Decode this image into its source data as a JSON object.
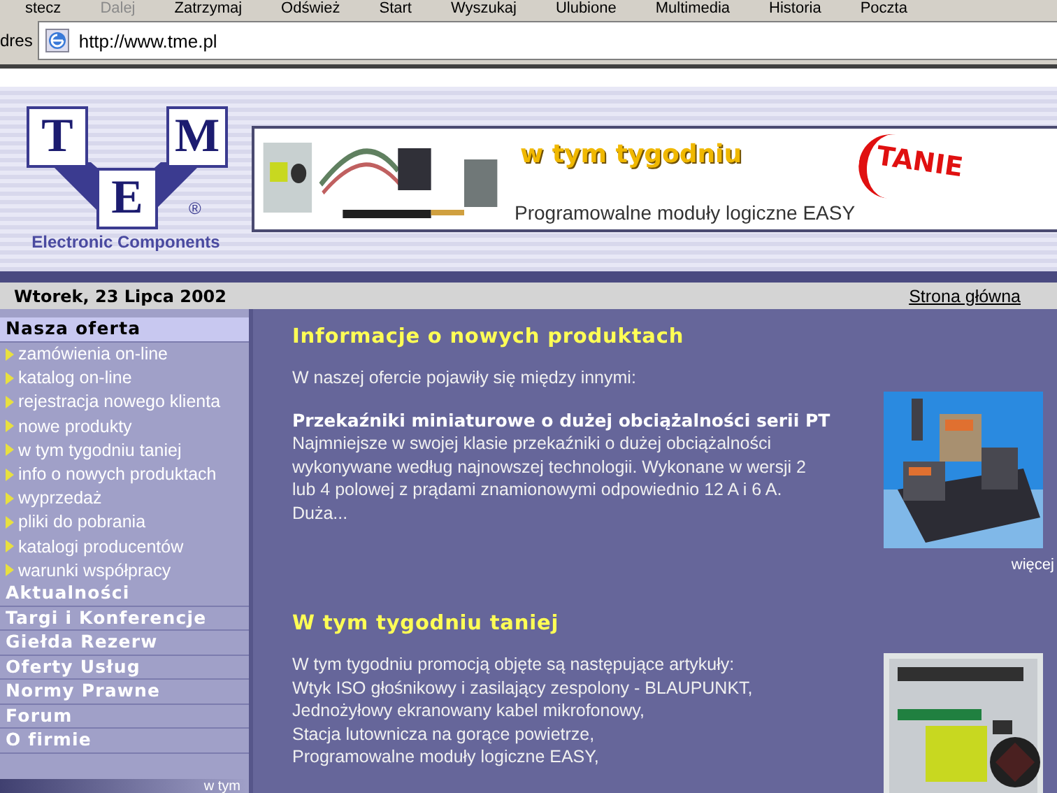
{
  "toolbar": {
    "buttons": [
      {
        "label": "stecz",
        "disabled": false
      },
      {
        "label": "Dalej",
        "disabled": true
      },
      {
        "label": "Zatrzymaj",
        "disabled": false
      },
      {
        "label": "Odśwież",
        "disabled": false
      },
      {
        "label": "Start",
        "disabled": false
      },
      {
        "label": "Wyszukaj",
        "disabled": false
      },
      {
        "label": "Ulubione",
        "disabled": false
      },
      {
        "label": "Multimedia",
        "disabled": false
      },
      {
        "label": "Historia",
        "disabled": false
      },
      {
        "label": "Poczta",
        "disabled": false
      }
    ]
  },
  "address_bar": {
    "label": "dres",
    "value": "http://www.tme.pl"
  },
  "logo": {
    "letters": [
      "T",
      "M",
      "E"
    ],
    "registered": "®",
    "tagline": "Electronic Components"
  },
  "banner": {
    "headline": "w tym tygodniu",
    "stamp": "TANIE",
    "caption": "Programowalne moduły logiczne EASY"
  },
  "date_bar": {
    "date": "Wtorek, 23 Lipca 2002",
    "home_link": "Strona główna"
  },
  "sidebar": {
    "sections": [
      {
        "label": "Nasza oferta",
        "selected": true,
        "items": [
          "zamówienia on-line",
          "katalog on-line",
          "rejestracja nowego klienta",
          "nowe produkty",
          "w tym tygodniu taniej",
          "info o nowych produktach",
          "wyprzedaż",
          "pliki do pobrania",
          "katalogi producentów",
          "warunki współpracy"
        ]
      },
      {
        "label": "Aktualności",
        "selected": false
      },
      {
        "label": "Targi i Konferencje",
        "selected": false
      },
      {
        "label": "Giełda Rezerw",
        "selected": false
      },
      {
        "label": "Oferty Usług",
        "selected": false
      },
      {
        "label": "Normy Prawne",
        "selected": false
      },
      {
        "label": "Forum",
        "selected": false
      },
      {
        "label": "O firmie",
        "selected": false
      }
    ],
    "footer": "w tym"
  },
  "articles": [
    {
      "title": "Informacje o nowych produktach",
      "intro": "W naszej ofercie pojawiły się między innymi:",
      "product_title": "Przekaźniki miniaturowe o dużej obciążalności serii PT",
      "lines": [
        "Najmniejsze w swojej klasie przekaźniki o dużej obciążalności",
        "wykonywane według najnowszej technologii. Wykonane w wersji 2",
        "lub 4 polowej z prądami znamionowymi odpowiednio 12 A i 6 A.",
        "Duża..."
      ],
      "image": {
        "kind": "picture"
      },
      "more": "więcej"
    },
    {
      "title": "W tym tygodniu taniej",
      "lines": [
        "W tym tygodniu promocją objęte są następujące artykuły:",
        "Wtyk ISO głośnikowy i zasilający zespolony - BLAUPUNKT,",
        "Jednożyłowy ekranowany kabel mikrofonowy,",
        "Stacja lutownicza na gorące powietrze,",
        "Programowalne moduły logiczne EASY,"
      ],
      "image": {
        "kind": "picture"
      }
    }
  ]
}
